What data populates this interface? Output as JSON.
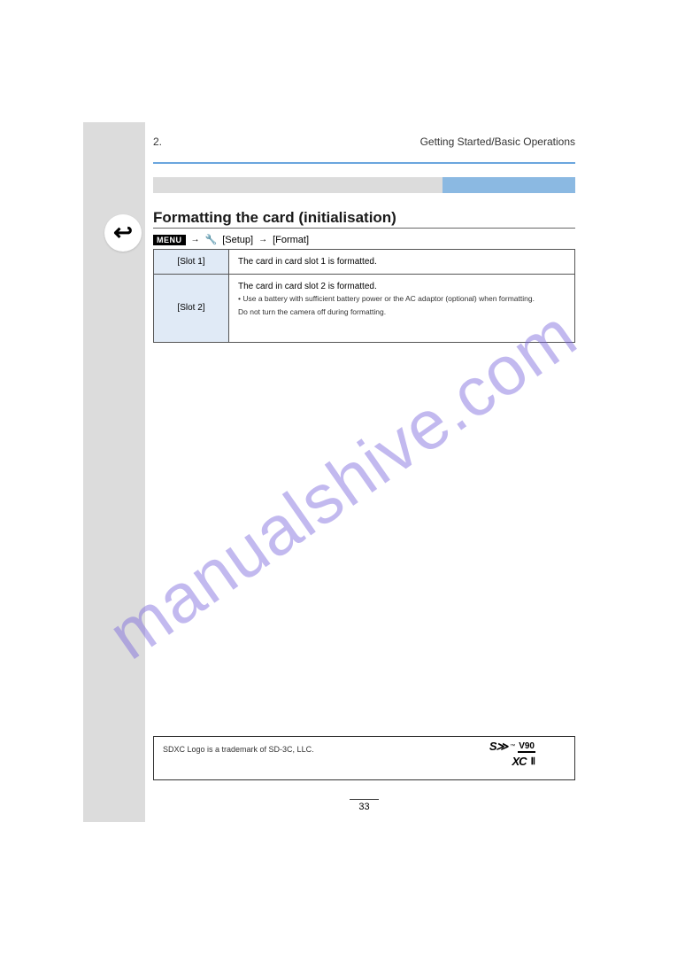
{
  "chapter": {
    "number": "2.",
    "title": "Getting Started/Basic Operations"
  },
  "tabs": {
    "inactive": "",
    "active": ""
  },
  "section_title": "Formatting the card (initialisation)",
  "menu": {
    "label": "MENU",
    "setup": "[Setup]",
    "item": "[Format]"
  },
  "table": {
    "row1": {
      "label": "[Slot 1]",
      "text": "The card in card slot 1 is formatted."
    },
    "row2": {
      "label": "[Slot 2]",
      "text": "The card in card slot 2 is formatted.",
      "note1": "• Use a battery with sufficient battery power or the AC adaptor (optional) when formatting.",
      "note2": "Do not turn the camera off during formatting."
    }
  },
  "footnote": "SDXC Logo is a trademark of SD-3C, LLC.",
  "page_number": "33",
  "watermark": "manualshive.com"
}
